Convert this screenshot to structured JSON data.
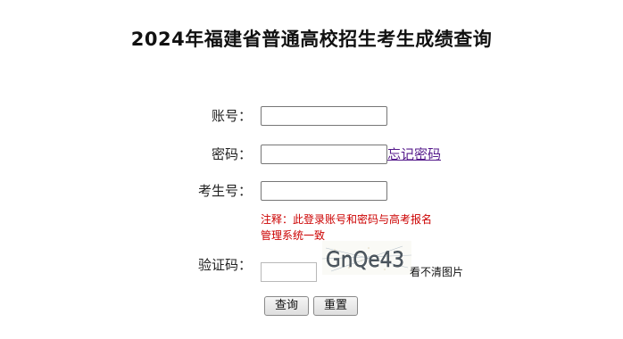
{
  "page_title": "2024年福建省普通高校招生考生成绩查询",
  "form": {
    "account_label": "账号：",
    "account_value": "",
    "password_label": "密码：",
    "password_value": "",
    "forgot_password_link": "忘记密码",
    "exam_number_label": "考生号：",
    "exam_number_value": "",
    "note_line1": "注释：此登录账号和密码与高考报名",
    "note_line2": "管理系统一致",
    "captcha_label": "验证码：",
    "captcha_value": "",
    "captcha_text": "GnQe43",
    "captcha_refresh_link": "看不清图片",
    "query_button": "查询",
    "reset_button": "重置"
  }
}
